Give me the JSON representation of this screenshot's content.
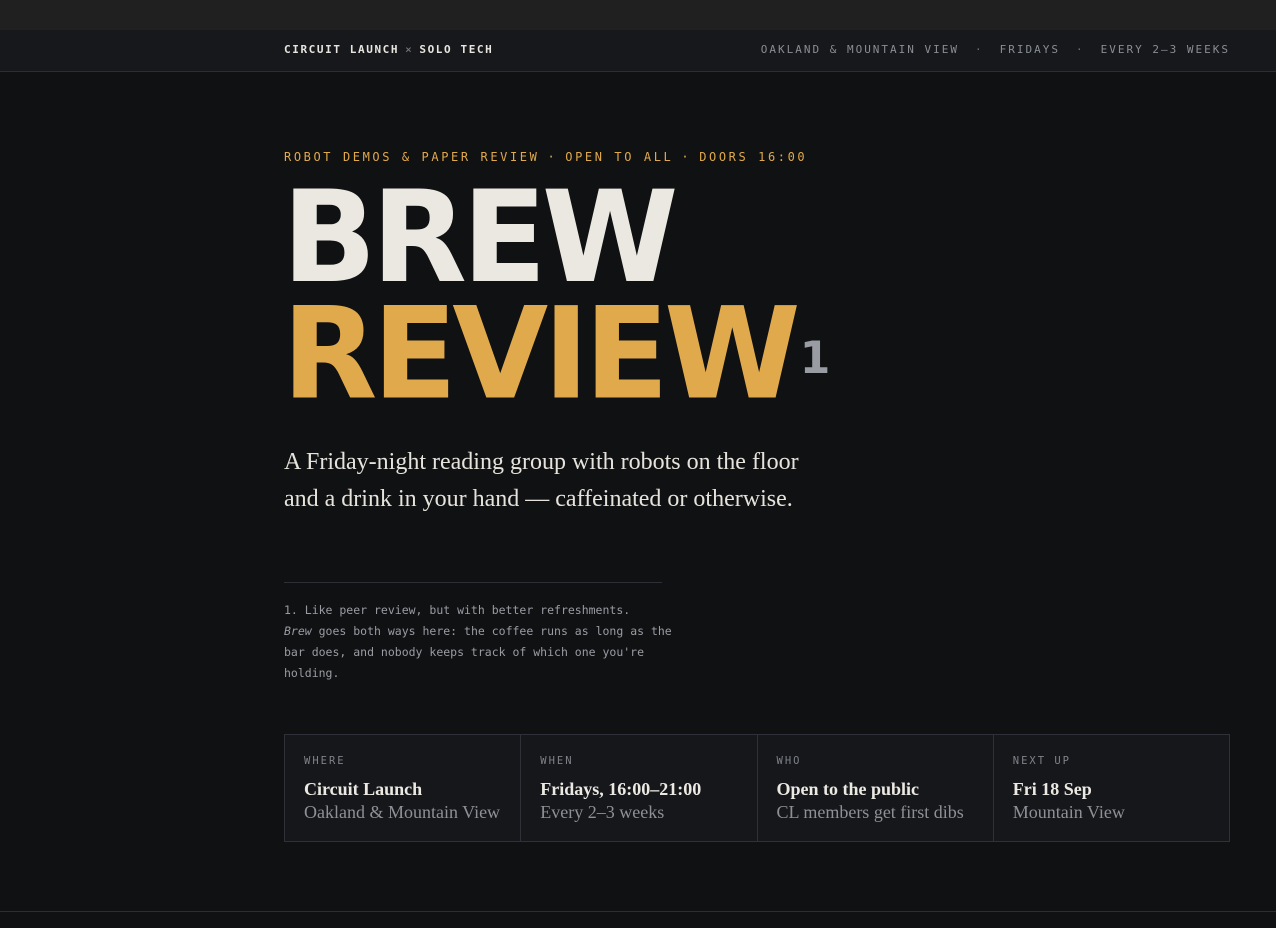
{
  "nav": {
    "brand_left": "CIRCUIT LAUNCH",
    "brand_sep": "×",
    "brand_right": "SOLO TECH",
    "meta": [
      "OAKLAND & MOUNTAIN VIEW",
      "FRIDAYS",
      "EVERY 2–3 WEEKS"
    ],
    "meta_sep": "·"
  },
  "hero": {
    "eyebrow": [
      "ROBOT DEMOS & PAPER REVIEW",
      "OPEN TO ALL",
      "DOORS 16:00"
    ],
    "eyebrow_sep": "·",
    "title_line1": "BREW",
    "title_line2": "REVIEW",
    "footnote_mark": "1",
    "lede": "A Friday-night reading group with robots on the floor and a drink in your hand — caffeinated or otherwise.",
    "footnote_prefix": "1. Like peer review, but with better refreshments.",
    "footnote_em": "Brew",
    "footnote_rest": " goes both ways here: the coffee runs as long as the bar does, and nobody keeps track of which one you're holding."
  },
  "details": [
    {
      "label": "WHERE",
      "main": "Circuit Launch",
      "sub": "Oakland & Mountain View"
    },
    {
      "label": "WHEN",
      "main": "Fridays, 16:00–21:00",
      "sub": "Every 2–3 weeks"
    },
    {
      "label": "WHO",
      "main": "Open to the public",
      "sub": "CL members get first dibs"
    },
    {
      "label": "NEXT UP",
      "main": "Fri 18 Sep",
      "sub": "Mountain View"
    }
  ],
  "colors": {
    "background": "#101113",
    "accent": "#e0a94c",
    "text": "#ebe8e1",
    "muted": "#8e9097"
  }
}
